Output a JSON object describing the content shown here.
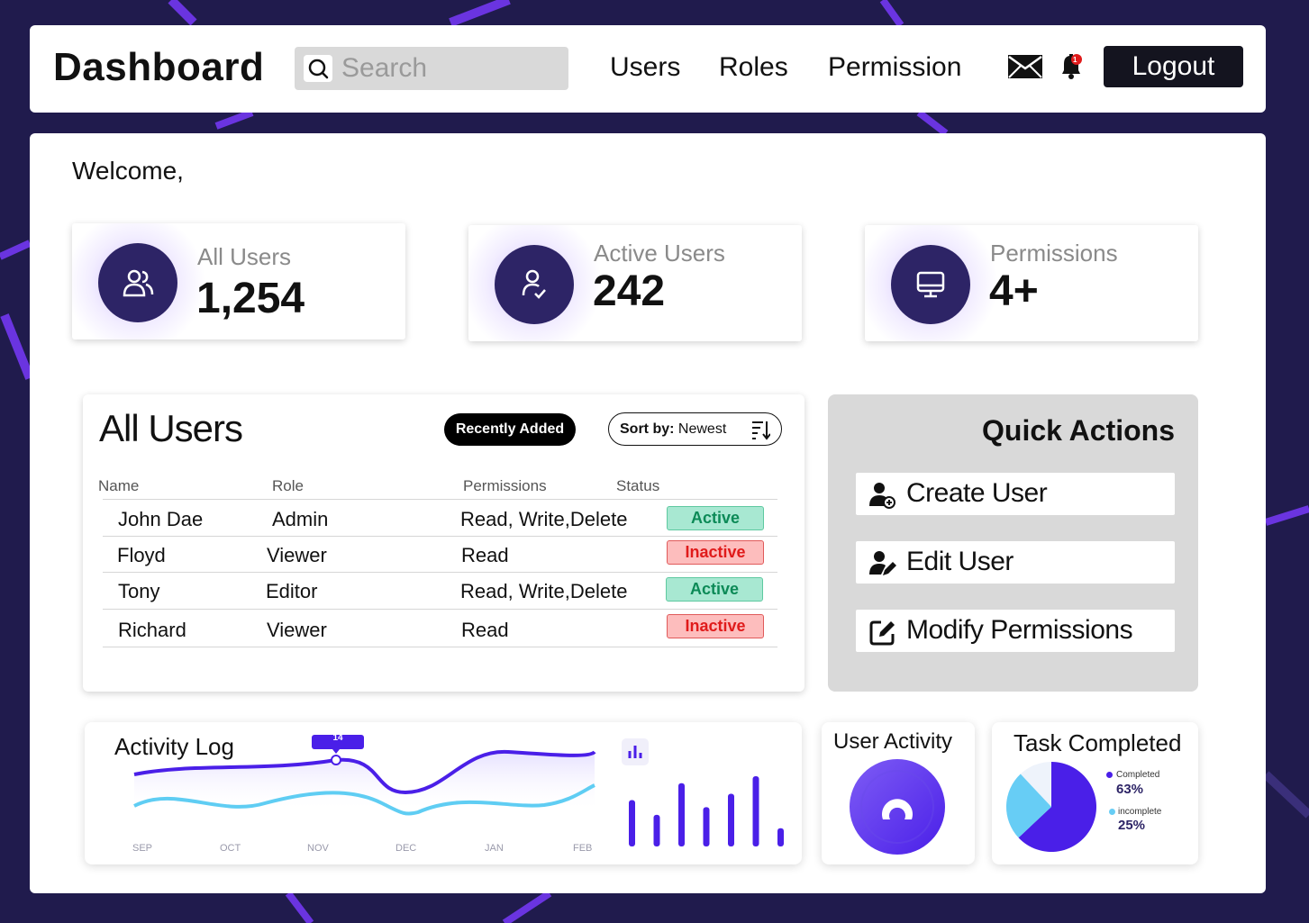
{
  "header": {
    "title": "Dashboard",
    "search_placeholder": "Search",
    "nav": [
      "Users",
      "Roles",
      "Permission"
    ],
    "mail_icon": "mail-icon",
    "bell_icon": "bell-icon",
    "notification_count": "1",
    "logout_label": "Logout"
  },
  "welcome": "Welcome,",
  "stats": [
    {
      "label": "All Users",
      "value": "1,254",
      "icon": "users-icon"
    },
    {
      "label": "Active Users",
      "value": "242",
      "icon": "user-check-icon"
    },
    {
      "label": "Permissions",
      "value": "4+",
      "icon": "monitor-icon"
    }
  ],
  "users_table": {
    "title": "All Users",
    "recent_label": "Recently Added",
    "sort_prefix": "Sort by:",
    "sort_value": "Newest",
    "columns": [
      "Name",
      "Role",
      "Permissions",
      "Status"
    ],
    "rows": [
      {
        "name": "John Dae",
        "role": "Admin",
        "permissions": "Read, Write,Delete",
        "status": "Active"
      },
      {
        "name": "Floyd",
        "role": "Viewer",
        "permissions": "Read",
        "status": "Inactive"
      },
      {
        "name": "Tony",
        "role": "Editor",
        "permissions": "Read, Write,Delete",
        "status": "Active"
      },
      {
        "name": "Richard",
        "role": "Viewer",
        "permissions": "Read",
        "status": "Inactive"
      }
    ]
  },
  "quick_actions": {
    "title": "Quick Actions",
    "items": [
      {
        "label": "Create User",
        "icon": "user-add-icon"
      },
      {
        "label": "Edit User",
        "icon": "user-edit-icon"
      },
      {
        "label": "Modify Permissions",
        "icon": "edit-square-icon"
      }
    ]
  },
  "activity_log": {
    "title": "Activity Log",
    "tooltip": "14",
    "months": [
      "SEP",
      "OCT",
      "NOV",
      "DEC",
      "JAN",
      "FEB"
    ],
    "bar_icon": "bar-chart-icon",
    "bar_levels": [
      0.66,
      0.45,
      0.9,
      0.56,
      0.75,
      1.0,
      0.26
    ]
  },
  "user_activity": {
    "title": "User Activity"
  },
  "task_completed": {
    "title": "Task Completed",
    "legend": [
      {
        "label": "Completed",
        "value": "63%",
        "color": "#4a1fe8"
      },
      {
        "label": "incomplete",
        "value": "25%",
        "color": "#67cdf5"
      }
    ]
  },
  "colors": {
    "accent": "#2d2466",
    "purple": "#4a1fe8",
    "cyan": "#67cdf5",
    "active_green": "#0c8a57",
    "inactive_red": "#e01b1b"
  }
}
